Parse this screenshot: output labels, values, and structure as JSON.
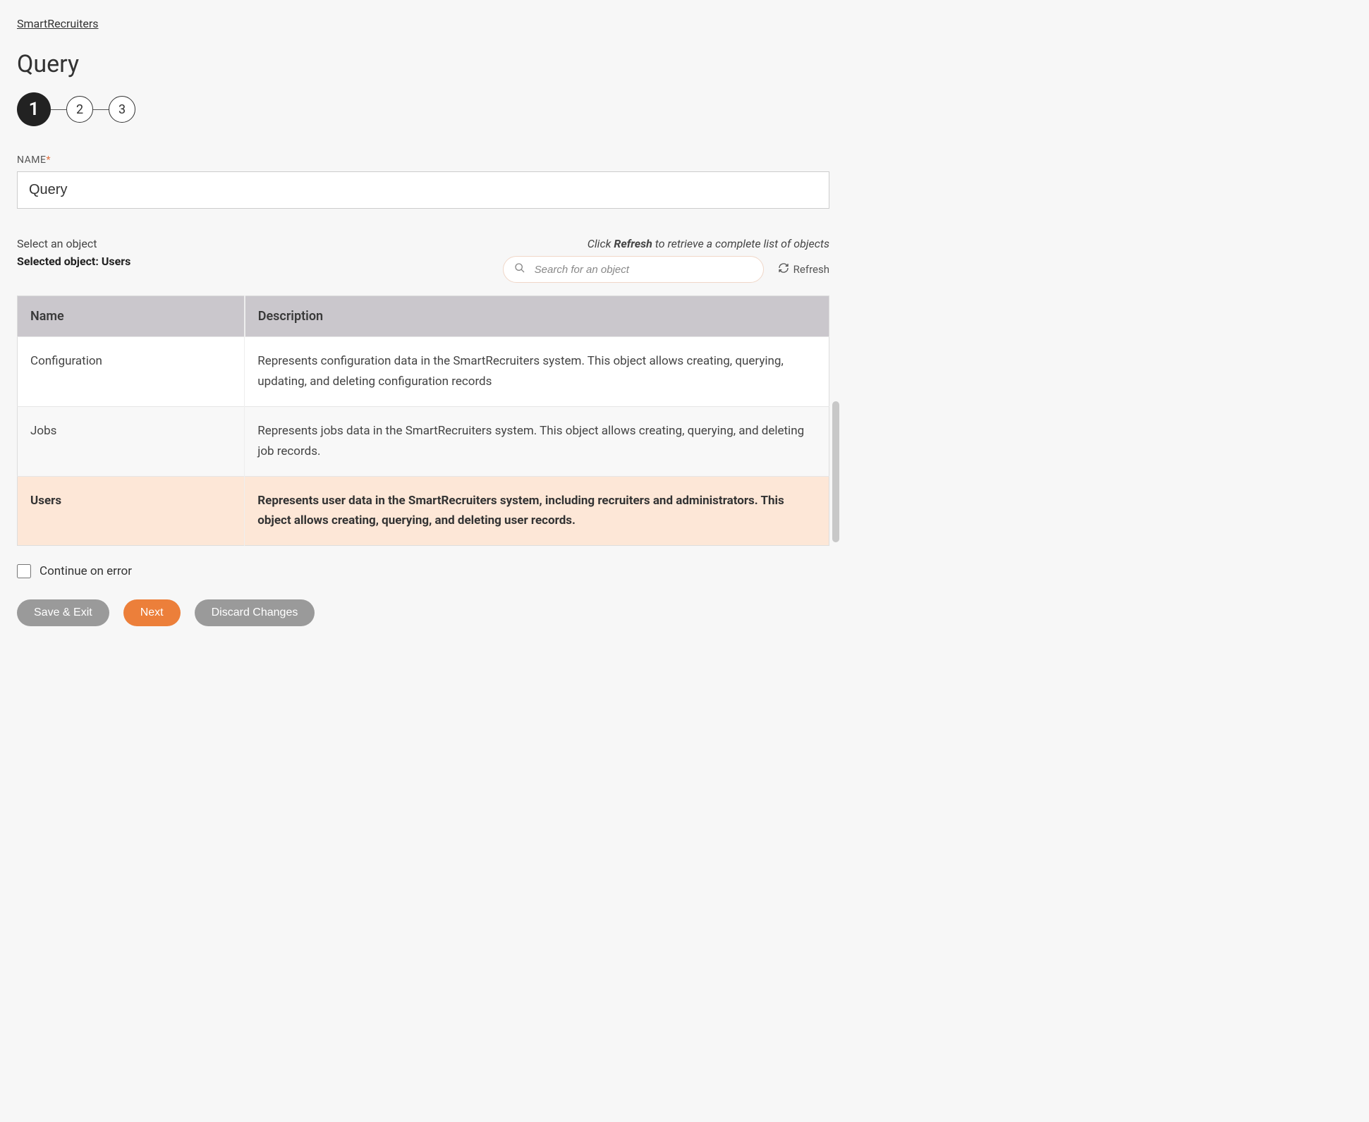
{
  "breadcrumb": "SmartRecruiters",
  "page_title": "Query",
  "stepper": {
    "steps": [
      "1",
      "2",
      "3"
    ],
    "active_index": 0
  },
  "name_field": {
    "label": "NAME",
    "required_marker": "*",
    "value": "Query"
  },
  "object_section": {
    "select_label": "Select an object",
    "selected_prefix": "Selected object: ",
    "selected_value": "Users",
    "hint_prefix": "Click ",
    "hint_strong": "Refresh",
    "hint_suffix": " to retrieve a complete list of objects",
    "search_placeholder": "Search for an object",
    "refresh_label": "Refresh"
  },
  "table": {
    "headers": {
      "name": "Name",
      "description": "Description"
    },
    "rows": [
      {
        "name": "Configuration",
        "description": "Represents configuration data in the SmartRecruiters system. This object allows creating, querying, updating, and deleting configuration records",
        "selected": false,
        "alt": false
      },
      {
        "name": "Jobs",
        "description": "Represents jobs data in the SmartRecruiters system. This object allows creating, querying, and deleting job records.",
        "selected": false,
        "alt": true
      },
      {
        "name": "Users",
        "description": "Represents user data in the SmartRecruiters system, including recruiters and administrators. This object allows creating, querying, and deleting user records.",
        "selected": true,
        "alt": false
      }
    ]
  },
  "continue_on_error_label": "Continue on error",
  "buttons": {
    "save_exit": "Save & Exit",
    "next": "Next",
    "discard": "Discard Changes"
  }
}
